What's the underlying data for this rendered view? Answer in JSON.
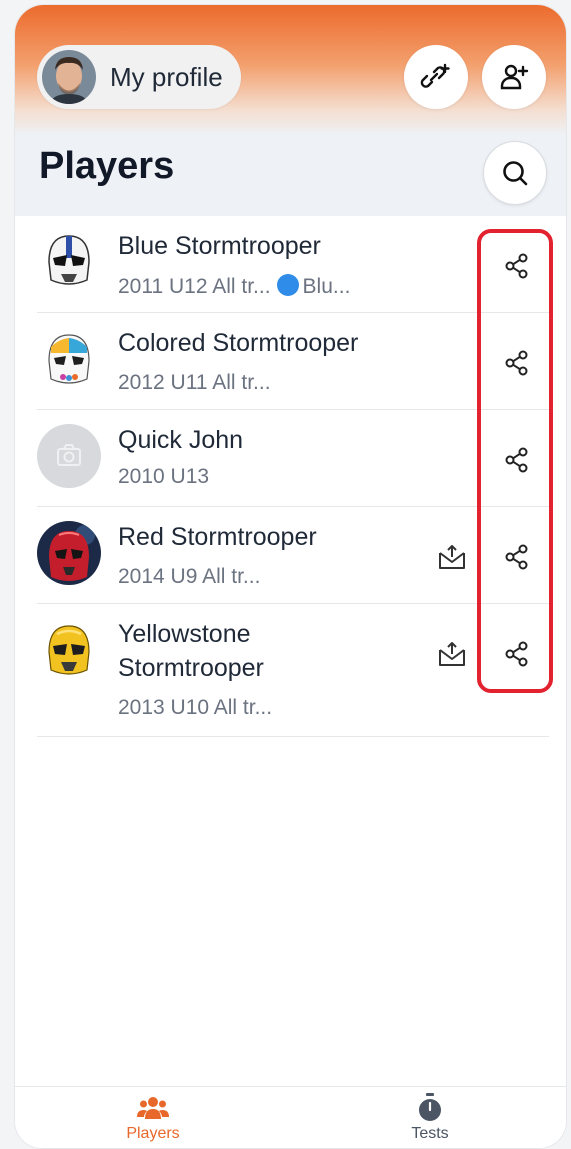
{
  "header": {
    "profile_label": "My profile",
    "link_icon": "link-plus-icon",
    "add_user_icon": "user-plus-icon",
    "search_icon": "search-icon"
  },
  "page_title": "Players",
  "players": [
    {
      "name": "Blue Stormtrooper",
      "subtitle": "2011 U12 All tr...",
      "team_suffix": "Blu...",
      "has_team_dot": true,
      "export": false
    },
    {
      "name": "Colored Stormtrooper",
      "subtitle": "2012 U11 All tr...",
      "export": false
    },
    {
      "name": "Quick John",
      "subtitle": "2010 U13",
      "export": false
    },
    {
      "name": "Red Stormtrooper",
      "subtitle": "2014 U9 All tr...",
      "export": true
    },
    {
      "name": "Yellowstone Stormtrooper",
      "name_line1": "Yellowstone",
      "name_line2": "Stormtrooper",
      "subtitle": "2013 U10 All tr...",
      "export": true
    }
  ],
  "nav": {
    "players_label": "Players",
    "tests_label": "Tests"
  },
  "colors": {
    "accent": "#e8682b",
    "highlight": "#e2222e",
    "team_dot": "#2f8ce8"
  }
}
